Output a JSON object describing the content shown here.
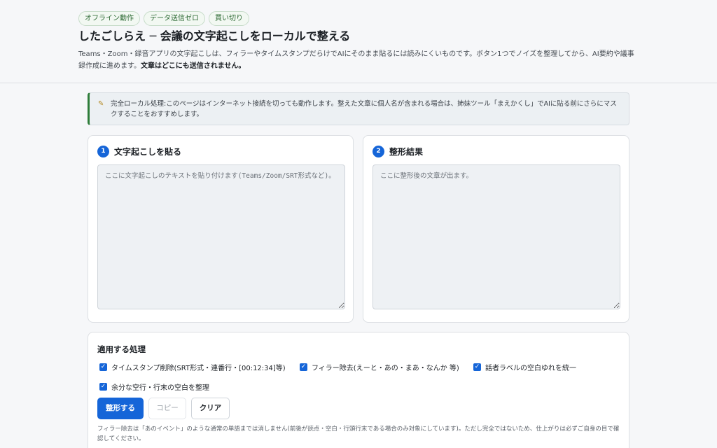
{
  "header": {
    "badges": [
      "オフライン動作",
      "データ送信ゼロ",
      "買い切り"
    ],
    "title": "したごしらえ ─ 会議の文字起こしをローカルで整える",
    "description": "Teams・Zoom・録音アプリの文字起こしは、フィラーやタイムスタンプだらけでAIにそのまま貼るには読みにくいものです。ボタン1つでノイズを整理してから、AI要約や議事録作成に進めます。",
    "description_strong": "文章はどこにも送信されません。"
  },
  "notice": {
    "icon": "memo-icon",
    "text": "完全ローカル処理:このページはインターネット接続を切っても動作します。整えた文章に個人名が含まれる場合は、姉妹ツール「まえかくし」でAIに貼る前にさらにマスクすることをおすすめします。"
  },
  "input_panel": {
    "step": "1",
    "label": "文字起こしを貼る",
    "placeholder": "ここに文字起こしのテキストを貼り付けます(Teams/Zoom/SRT形式など)。"
  },
  "output_panel": {
    "step": "2",
    "label": "整形結果",
    "placeholder": "ここに整形後の文章が出ます。"
  },
  "options": {
    "title": "適用する処理",
    "items": [
      {
        "label": "タイムスタンプ削除(SRT形式・連番行・[00:12:34]等)",
        "checked": true
      },
      {
        "label": "フィラー除去(えーと・あの・まあ・なんか 等)",
        "checked": true
      },
      {
        "label": "話者ラベルの空白ゆれを統一",
        "checked": true
      },
      {
        "label": "余分な空行・行末の空白を整理",
        "checked": true
      }
    ],
    "buttons": {
      "format": "整形する",
      "copy": "コピー",
      "clear": "クリア"
    },
    "note": "フィラー除去は「あのイベント」のような通常の単語までは消しません(前後が読点・空白・行頭行末である場合のみ対象にしています)。ただし完全ではないため、仕上がりは必ずご自身の目で確認してください。"
  },
  "colors": {
    "accent": "#1565d8",
    "badge_green": "#2d6a34",
    "notice_border": "#2e7d3a"
  }
}
